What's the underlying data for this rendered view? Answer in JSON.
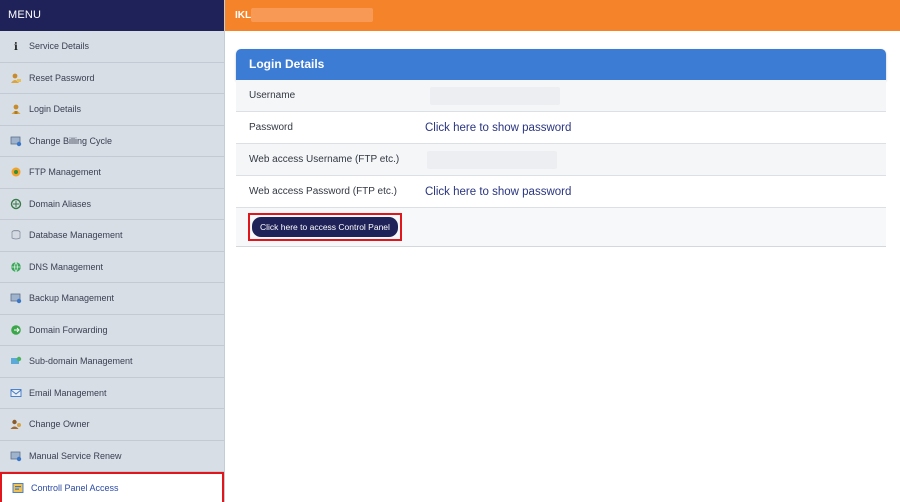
{
  "sidebar": {
    "title": "MENU",
    "items": [
      {
        "label": "Service Details",
        "icon": "info-icon"
      },
      {
        "label": "Reset Password",
        "icon": "user-key-icon"
      },
      {
        "label": "Login Details",
        "icon": "user-lock-icon"
      },
      {
        "label": "Change Billing Cycle",
        "icon": "billing-cycle-icon"
      },
      {
        "label": "FTP Management",
        "icon": "ftp-icon"
      },
      {
        "label": "Domain Aliases",
        "icon": "domain-alias-icon"
      },
      {
        "label": "Database Management",
        "icon": "database-icon"
      },
      {
        "label": "DNS Management",
        "icon": "dns-globe-icon"
      },
      {
        "label": "Backup Management",
        "icon": "backup-icon"
      },
      {
        "label": "Domain Forwarding",
        "icon": "forwarding-globe-icon"
      },
      {
        "label": "Sub-domain Management",
        "icon": "subdomain-icon"
      },
      {
        "label": "Email Management",
        "icon": "email-icon"
      },
      {
        "label": "Change Owner",
        "icon": "owner-icon"
      },
      {
        "label": "Manual Service Renew",
        "icon": "renew-icon"
      },
      {
        "label": "Controll Panel Access",
        "icon": "control-panel-icon",
        "active": true
      }
    ]
  },
  "topbar": {
    "title": "IKL"
  },
  "panel": {
    "header": "Login Details",
    "rows": [
      {
        "label": "Username",
        "value": ""
      },
      {
        "label": "Password",
        "link": "Click here to show password"
      },
      {
        "label": "Web access Username (FTP etc.)",
        "value": ""
      },
      {
        "label": "Web access Password (FTP etc.)",
        "link": "Click here to show password"
      }
    ],
    "control_panel_button": "Click here to access Control Panel"
  },
  "colors": {
    "sidebar_bg": "#d7dee6",
    "sidebar_header": "#1f2259",
    "topbar": "#f5832a",
    "panel_header": "#3d7cd4",
    "highlight": "#e0161c",
    "button": "#1f2259"
  }
}
